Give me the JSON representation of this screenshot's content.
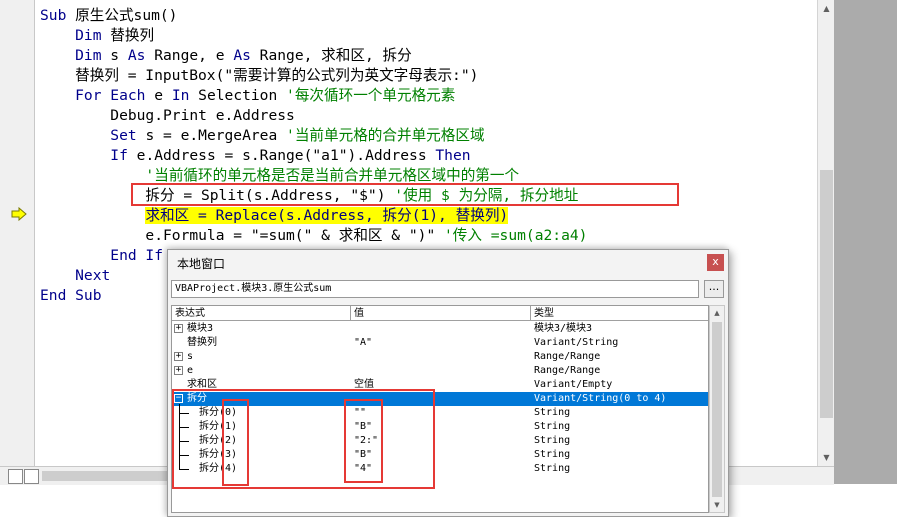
{
  "code": {
    "lines": [
      {
        "segs": [
          {
            "c": "kw",
            "t": "Sub "
          },
          {
            "c": "tx",
            "t": "原生公式sum()"
          }
        ]
      },
      {
        "segs": [
          {
            "c": "kw",
            "t": "    Dim "
          },
          {
            "c": "tx",
            "t": "替换列"
          }
        ]
      },
      {
        "segs": [
          {
            "c": "kw",
            "t": "    Dim "
          },
          {
            "c": "tx",
            "t": "s "
          },
          {
            "c": "kw",
            "t": "As "
          },
          {
            "c": "tx",
            "t": "Range, e "
          },
          {
            "c": "kw",
            "t": "As "
          },
          {
            "c": "tx",
            "t": "Range, 求和区, 拆分"
          }
        ]
      },
      {
        "segs": [
          {
            "c": "tx",
            "t": "    替换列 = InputBox(\"需要计算的公式列为英文字母表示:\")"
          }
        ]
      },
      {
        "segs": [
          {
            "c": "kw",
            "t": "    For Each "
          },
          {
            "c": "tx",
            "t": "e "
          },
          {
            "c": "kw",
            "t": "In "
          },
          {
            "c": "tx",
            "t": "Selection "
          },
          {
            "c": "cm",
            "t": "'每次循环一个单元格元素"
          }
        ]
      },
      {
        "segs": [
          {
            "c": "tx",
            "t": "        Debug.Print e.Address"
          }
        ]
      },
      {
        "segs": [
          {
            "c": "kw",
            "t": "        Set "
          },
          {
            "c": "tx",
            "t": "s = e.MergeArea "
          },
          {
            "c": "cm",
            "t": "'当前单元格的合并单元格区域"
          }
        ]
      },
      {
        "segs": [
          {
            "c": "kw",
            "t": "        If "
          },
          {
            "c": "tx",
            "t": "e.Address = s.Range(\"a1\").Address "
          },
          {
            "c": "kw",
            "t": "Then"
          }
        ]
      },
      {
        "segs": [
          {
            "c": "cm",
            "t": "            '当前循环的单元格是否是当前合并单元格区域中的第一个"
          }
        ]
      },
      {
        "segs": [
          {
            "c": "tx",
            "t": "            拆分 = Split(s.Address, \"$\") "
          },
          {
            "c": "cm",
            "t": "'使用 $ 为分隔, 拆分地址"
          }
        ]
      },
      {
        "segs": [
          {
            "c": "tx",
            "t": "            "
          },
          {
            "c": "hl",
            "t": "求和区 = Replace(s.Address, 拆分(1), 替换列)"
          }
        ]
      },
      {
        "segs": [
          {
            "c": "tx",
            "t": "            e.Formula = \"=sum(\" & 求和区 & \")\" "
          },
          {
            "c": "cm",
            "t": "'传入 =sum(a2:a4)"
          }
        ]
      },
      {
        "segs": [
          {
            "c": "kw",
            "t": "        End If"
          }
        ]
      },
      {
        "segs": [
          {
            "c": "kw",
            "t": "    Next"
          }
        ]
      },
      {
        "segs": [
          {
            "c": "kw",
            "t": "End Sub"
          }
        ]
      }
    ]
  },
  "locals_window": {
    "title": "本地窗口",
    "close_label": "x",
    "context": "VBAProject.模块3.原生公式sum",
    "context_button": "...",
    "headers": {
      "expr": "表达式",
      "value": "值",
      "type": "类型"
    },
    "rows": [
      {
        "expander": "+",
        "expr": "模块3",
        "value": "",
        "type": "模块3/模块3"
      },
      {
        "expander": "",
        "expr": "替换列",
        "value": "\"A\"",
        "type": "Variant/String"
      },
      {
        "expander": "+",
        "expr": "s",
        "value": "",
        "type": "Range/Range"
      },
      {
        "expander": "+",
        "expr": "e",
        "value": "",
        "type": "Range/Range"
      },
      {
        "expander": "",
        "expr": "求和区",
        "value": "空值",
        "type": "Variant/Empty"
      },
      {
        "expander": "-",
        "expr": "拆分",
        "value": "",
        "type": "Variant/String(0 to 4)",
        "selected": true
      },
      {
        "expander": "",
        "child": true,
        "expr": "拆分(0)",
        "value": "\"\"",
        "type": "String"
      },
      {
        "expander": "",
        "child": true,
        "expr": "拆分(1)",
        "value": "\"B\"",
        "type": "String"
      },
      {
        "expander": "",
        "child": true,
        "expr": "拆分(2)",
        "value": "\"2:\"",
        "type": "String"
      },
      {
        "expander": "",
        "child": true,
        "expr": "拆分(3)",
        "value": "\"B\"",
        "type": "String"
      },
      {
        "expander": "",
        "child": true,
        "expr": "拆分(4)",
        "value": "\"4\"",
        "type": "String"
      }
    ]
  },
  "scrollbar_arrows": {
    "up": "▲",
    "down": "▼"
  }
}
